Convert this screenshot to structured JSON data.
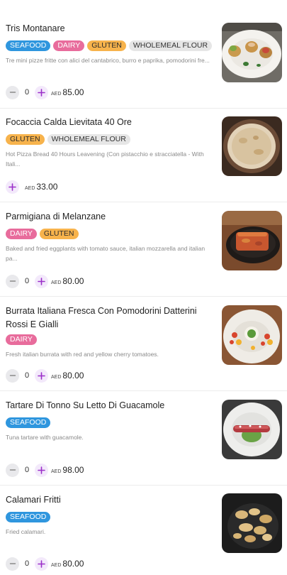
{
  "items": [
    {
      "title": "Tris Montanare",
      "tags": [
        "SEAFOOD",
        "DAIRY",
        "GLUTEN",
        "WHOLEMEAL FLOUR"
      ],
      "description": "Tre mini pizze fritte con alici del cantabrico, burro e paprika, pomodorini fre...",
      "quantity": "0",
      "currency": "AED",
      "price": "85.00",
      "image_icon": "fried-pizza-plate-photo"
    },
    {
      "title": "Focaccia Calda Lievitata 40 Ore",
      "tags": [
        "GLUTEN",
        "WHOLEMEAL FLOUR"
      ],
      "description": "Hot Pizza Bread 40 Hours Leavening (Con pistacchio e stracciatella - With Itali...",
      "quantity": "",
      "currency": "AED",
      "price": "33.00",
      "image_icon": "focaccia-photo"
    },
    {
      "title": "Parmigiana di Melanzane",
      "tags": [
        "DAIRY",
        "GLUTEN"
      ],
      "description": "Baked and fried eggplants with tomato sauce, italian mozzarella and italian pa...",
      "quantity": "0",
      "currency": "AED",
      "price": "80.00",
      "image_icon": "parmigiana-pan-photo"
    },
    {
      "title": "Burrata Italiana Fresca Con Pomodorini Datterini Rossi E Gialli",
      "tags": [
        "DAIRY"
      ],
      "description": "Fresh italian burrata with red and yellow cherry tomatoes.",
      "quantity": "0",
      "currency": "AED",
      "price": "80.00",
      "image_icon": "burrata-plate-photo"
    },
    {
      "title": "Tartare Di Tonno Su Letto Di Guacamole",
      "tags": [
        "SEAFOOD"
      ],
      "description": "Tuna tartare with guacamole.",
      "quantity": "0",
      "currency": "AED",
      "price": "98.00",
      "image_icon": "tuna-tartare-plate-photo"
    },
    {
      "title": "Calamari Fritti",
      "tags": [
        "SEAFOOD"
      ],
      "description": "Fried calamari.",
      "quantity": "0",
      "currency": "AED",
      "price": "80.00",
      "image_icon": "fried-calamari-photo"
    }
  ],
  "colors": {
    "seafood": "#2f96de",
    "dairy": "#e86c9c",
    "gluten": "#f7b34c",
    "wholemeal": "#e6e6e6",
    "accent": "#9b2fc9"
  }
}
